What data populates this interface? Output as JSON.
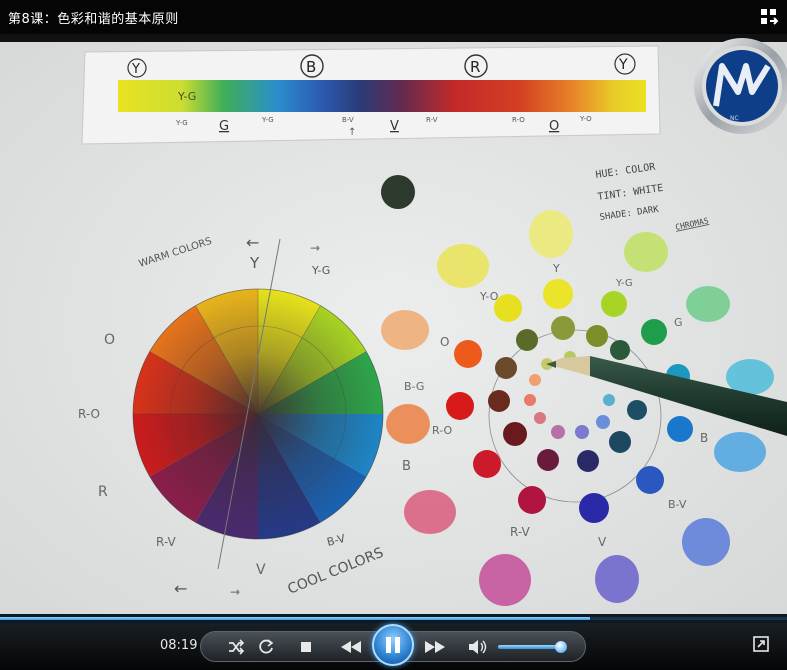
{
  "window": {
    "title": "第8课：色彩和谐的基本原则"
  },
  "playback": {
    "current_time": "08:19",
    "progress_fraction": 0.75,
    "volume_fraction": 0.9
  },
  "controls": {
    "shuffle": "shuffle-icon",
    "repeat": "repeat-icon",
    "stop": "stop-icon",
    "previous": "rewind-icon",
    "play_pause": "pause-icon",
    "next": "fast-forward-icon",
    "volume": "speaker-icon",
    "fullscreen": "fullscreen-icon",
    "layout": "layout-switch-icon"
  },
  "video": {
    "strip_top_labels": [
      "Y",
      "B",
      "R",
      "Y"
    ],
    "strip_inner_labels": [
      "Y-G"
    ],
    "strip_bottom_labels": [
      "Y-G",
      "G",
      "Y-G",
      "B-V",
      "V",
      "R-V",
      "R-O",
      "O",
      "Y-O"
    ],
    "strip_arrow": "↑",
    "notes": [
      "HUE: COLOR",
      "TINT: WHITE",
      "SHADE: DARK",
      "CHROMAS"
    ],
    "wheel_labels": {
      "warm": "WARM COLORS",
      "cool": "COOL COLORS",
      "arrow_top": "←",
      "arrow_top_right": "→",
      "arrow_bottom_left": "←",
      "arrow_bottom": "→",
      "y": "Y",
      "yg": "Y-G",
      "o": "O",
      "ro": "R-O",
      "r": "R",
      "rv": "R-V",
      "v": "V",
      "bv": "B-V"
    },
    "dot_labels": {
      "y": "Y",
      "yo": "Y-O",
      "yg": "Y-G",
      "g": "G",
      "o": "O",
      "bg": "B-G",
      "ro": "R-O",
      "b_left": "B",
      "b_right": "B",
      "bv": "B-V",
      "rv": "R-V",
      "v": "V"
    },
    "watermark": "NC"
  },
  "colors": {
    "accent_blue": "#3c9be0",
    "paper": "#e7e9e8"
  }
}
